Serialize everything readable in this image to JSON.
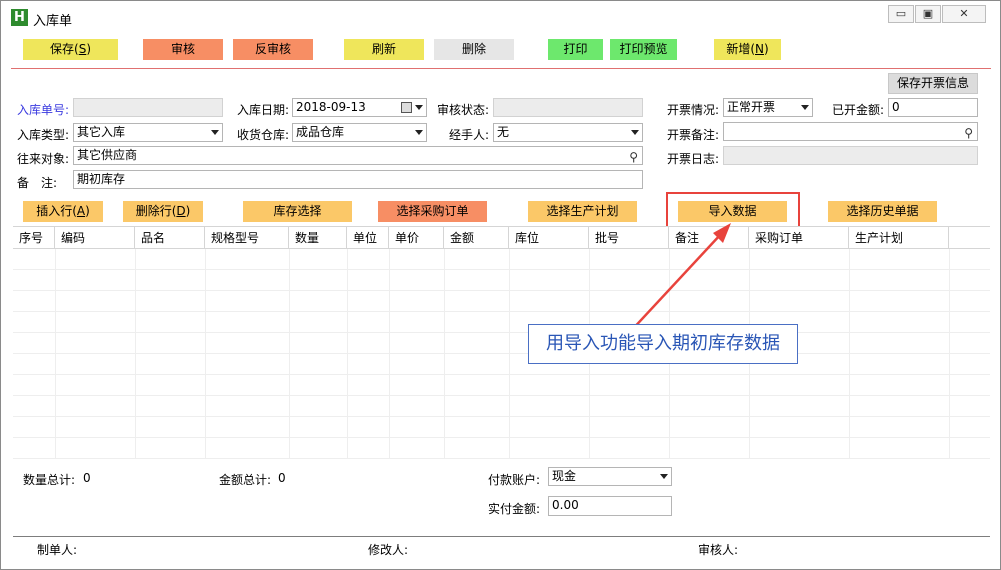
{
  "window": {
    "icon_letter": "H",
    "title": "入库单",
    "minimize": "▭",
    "maximize": "▣",
    "close": "✕"
  },
  "toolbar": {
    "save": "保存(",
    "save_key": "S",
    "save_end": ")",
    "audit": "审核",
    "unaudit": "反审核",
    "refresh": "刷新",
    "delete": "删除",
    "print": "打印",
    "print_preview": "打印预览",
    "new": "新增(",
    "new_key": "N",
    "new_end": ")"
  },
  "form": {
    "order_no_label": "入库单号:",
    "order_no_value": "",
    "date_label": "入库日期:",
    "date_value": "2018-09-13",
    "audit_status_label": "审核状态:",
    "audit_status_value": "",
    "invoice_status_label": "开票情况:",
    "invoice_status_value": "正常开票",
    "invoiced_amount_label": "已开金额:",
    "invoiced_amount_value": "0",
    "type_label": "入库类型:",
    "type_value": "其它入库",
    "warehouse_label": "收货仓库:",
    "warehouse_value": "成品仓库",
    "handler_label": "经手人:",
    "handler_value": "无",
    "invoice_note_label": "开票备注:",
    "invoice_note_value": "",
    "partner_label": "往来对象:",
    "partner_value": "其它供应商",
    "invoice_log_label": "开票日志:",
    "invoice_log_value": "",
    "note_label": "备　注:",
    "note_value": "期初库存",
    "save_invoice_btn": "保存开票信息"
  },
  "actions": {
    "insert_row": "插入行(",
    "insert_row_key": "A",
    "insert_row_end": ")",
    "delete_row": "删除行(",
    "delete_row_key": "D",
    "delete_row_end": ")",
    "stock_select": "库存选择",
    "select_po": "选择采购订单",
    "select_plan": "选择生产计划",
    "import_data": "导入数据",
    "select_history": "选择历史单据"
  },
  "grid": {
    "columns": [
      "序号",
      "编码",
      "品名",
      "规格型号",
      "数量",
      "单位",
      "单价",
      "金额",
      "库位",
      "批号",
      "备注",
      "采购订单",
      "生产计划"
    ]
  },
  "annotation": {
    "text": "用导入功能导入期初库存数据"
  },
  "summary": {
    "qty_total_label": "数量总计:",
    "qty_total_value": "0",
    "amount_total_label": "金额总计:",
    "amount_total_value": "0",
    "pay_account_label": "付款账户:",
    "pay_account_value": "现金",
    "paid_amount_label": "实付金额:",
    "paid_amount_value": "0.00"
  },
  "footer": {
    "creator_label": "制单人:",
    "modifier_label": "修改人:",
    "auditor_label": "审核人:"
  },
  "colors": {
    "accent_red": "#e8433c",
    "annot_blue": "#2a56b6",
    "label_blue": "#3a3adf"
  },
  "icons": [
    "app-h-icon",
    "minimize-icon",
    "maximize-icon",
    "close-icon",
    "calendar-icon",
    "chevron-down-icon",
    "search-icon",
    "arrow-annotation"
  ]
}
